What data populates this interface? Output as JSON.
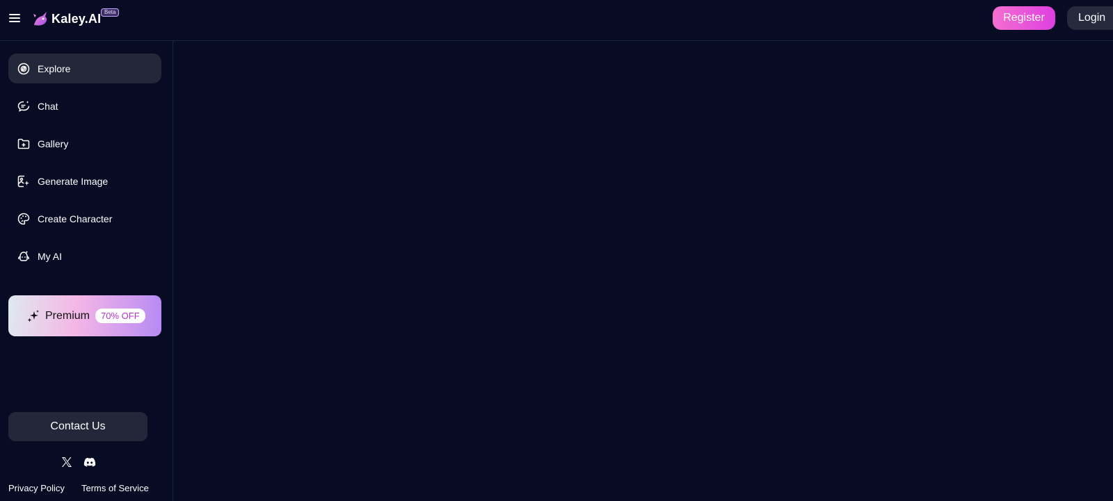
{
  "header": {
    "brand": "Kaley.AI",
    "badge": "Beta",
    "register_label": "Register",
    "login_label": "Login"
  },
  "sidebar": {
    "items": [
      {
        "label": "Explore",
        "icon": "compass-icon",
        "active": true
      },
      {
        "label": "Chat",
        "icon": "chat-bubble-icon",
        "active": false
      },
      {
        "label": "Gallery",
        "icon": "folder-image-icon",
        "active": false
      },
      {
        "label": "Generate Image",
        "icon": "image-sparkle-icon",
        "active": false
      },
      {
        "label": "Create Character",
        "icon": "palette-icon",
        "active": false
      },
      {
        "label": "My AI",
        "icon": "robot-icon",
        "active": false
      }
    ],
    "premium": {
      "label": "Premium",
      "badge": "70% OFF",
      "icon": "sparkle-icon"
    },
    "contact_label": "Contact Us",
    "social": [
      "x-icon",
      "discord-icon"
    ],
    "footer": {
      "privacy_label": "Privacy Policy",
      "terms_label": "Terms of Service"
    }
  },
  "colors": {
    "background": "#070b24",
    "surface": "#22273a",
    "accent_pink": "#f46fd0",
    "accent_magenta": "#de3fe0",
    "premium_badge_text": "#b533d6"
  }
}
